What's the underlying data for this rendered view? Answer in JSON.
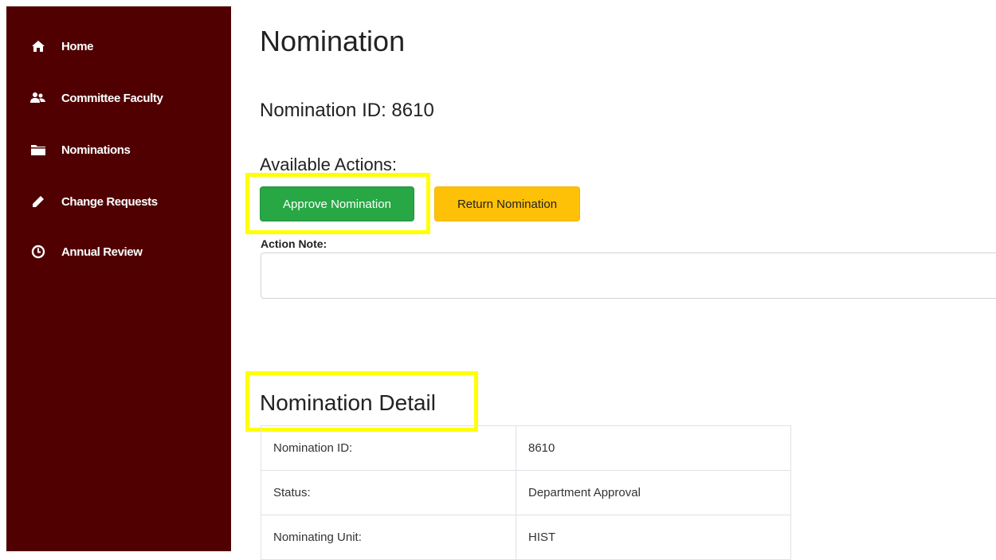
{
  "sidebar": {
    "items": [
      {
        "label": "Home",
        "icon": "home-icon"
      },
      {
        "label": "Committee Faculty",
        "icon": "users-icon"
      },
      {
        "label": "Nominations",
        "icon": "folder-icon"
      },
      {
        "label": "Change Requests",
        "icon": "pencil-icon"
      },
      {
        "label": "Annual Review",
        "icon": "clock-icon"
      }
    ],
    "background": "#500000"
  },
  "main": {
    "title": "Nomination",
    "nomination_id_heading": "Nomination ID: 8610",
    "actions_heading": "Available Actions:",
    "buttons": {
      "approve": "Approve Nomination",
      "return": "Return Nomination"
    },
    "action_note_label": "Action Note:",
    "action_note_value": "",
    "detail_heading": "Nomination Detail",
    "detail_rows": [
      {
        "label": "Nomination ID:",
        "value": "8610"
      },
      {
        "label": "Status:",
        "value": "Department Approval"
      },
      {
        "label": "Nominating Unit:",
        "value": "HIST"
      }
    ]
  },
  "colors": {
    "approve": "#28a745",
    "return": "#ffc107",
    "highlight": "#ffff00"
  }
}
